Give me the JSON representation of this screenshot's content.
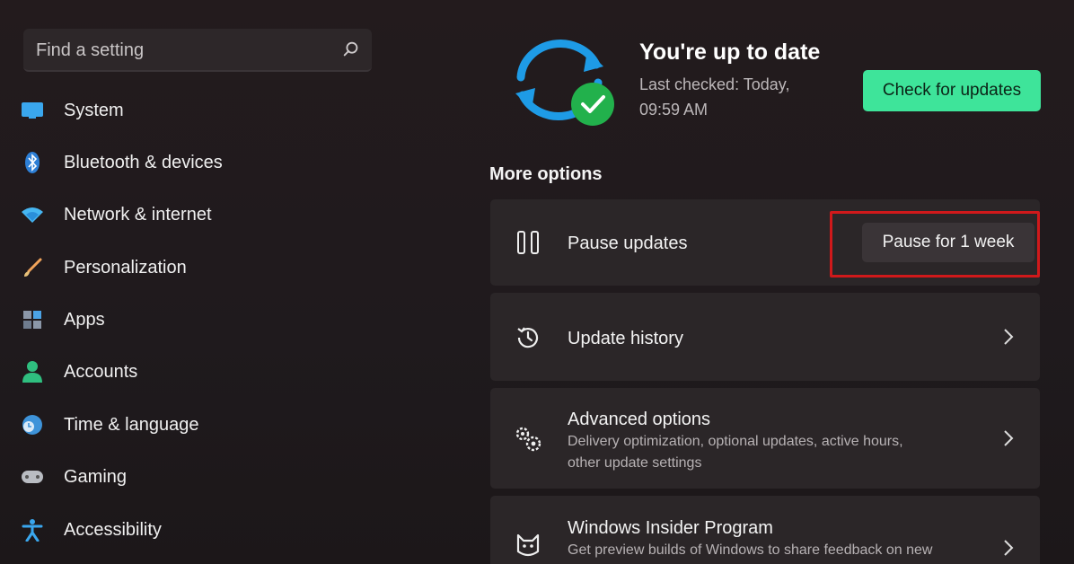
{
  "sidebar": {
    "search": {
      "placeholder": "Find a setting"
    },
    "items": [
      {
        "label": "System"
      },
      {
        "label": "Bluetooth & devices"
      },
      {
        "label": "Network & internet"
      },
      {
        "label": "Personalization"
      },
      {
        "label": "Apps"
      },
      {
        "label": "Accounts"
      },
      {
        "label": "Time & language"
      },
      {
        "label": "Gaming"
      },
      {
        "label": "Accessibility"
      }
    ]
  },
  "status": {
    "title": "You're up to date",
    "last_checked_line1": "Last checked: Today,",
    "last_checked_line2": "09:59 AM",
    "check_button": "Check for updates"
  },
  "more_options": {
    "heading": "More options",
    "pause": {
      "title": "Pause updates",
      "button": "Pause for 1 week"
    },
    "history": {
      "title": "Update history"
    },
    "advanced": {
      "title": "Advanced options",
      "desc_line1": "Delivery optimization, optional updates, active hours,",
      "desc_line2": "other update settings"
    },
    "insider": {
      "title": "Windows Insider Program",
      "desc_line1": "Get preview builds of Windows to share feedback on new"
    }
  },
  "colors": {
    "accent": "#3ee49a",
    "highlight": "#d0191b",
    "sync_blue": "#1e9be6",
    "check_green": "#22b14c"
  }
}
